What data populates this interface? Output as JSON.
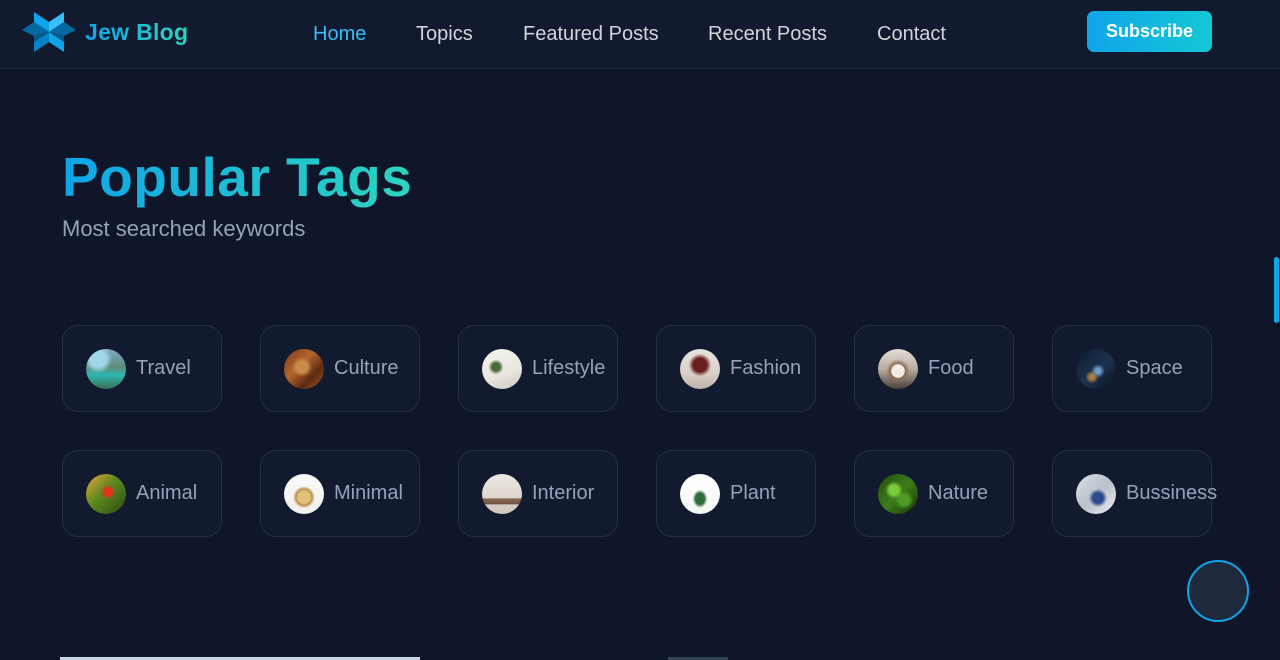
{
  "header": {
    "brand": "Jew Blog",
    "nav": [
      {
        "label": "Home",
        "active": true
      },
      {
        "label": "Topics",
        "active": false
      },
      {
        "label": "Featured Posts",
        "active": false
      },
      {
        "label": "Recent Posts",
        "active": false
      },
      {
        "label": "Contact",
        "active": false
      }
    ],
    "subscribe_label": "Subscribe"
  },
  "section": {
    "title": "Popular Tags",
    "subtitle": "Most searched keywords"
  },
  "tags": [
    {
      "label": "Travel",
      "icon": "travel-thumbnail"
    },
    {
      "label": "Culture",
      "icon": "culture-thumbnail"
    },
    {
      "label": "Lifestyle",
      "icon": "lifestyle-thumbnail"
    },
    {
      "label": "Fashion",
      "icon": "fashion-thumbnail"
    },
    {
      "label": "Food",
      "icon": "food-thumbnail"
    },
    {
      "label": "Space",
      "icon": "space-thumbnail"
    },
    {
      "label": "Animal",
      "icon": "animal-thumbnail"
    },
    {
      "label": "Minimal",
      "icon": "minimal-thumbnail"
    },
    {
      "label": "Interior",
      "icon": "interior-thumbnail"
    },
    {
      "label": "Plant",
      "icon": "plant-thumbnail"
    },
    {
      "label": "Nature",
      "icon": "nature-thumbnail"
    },
    {
      "label": "Bussiness",
      "icon": "business-thumbnail"
    }
  ],
  "colors": {
    "accent": "#0ea5e9",
    "accent_alt": "#2dd4bf",
    "background": "#0f1629",
    "muted_text": "#94a3b8"
  }
}
